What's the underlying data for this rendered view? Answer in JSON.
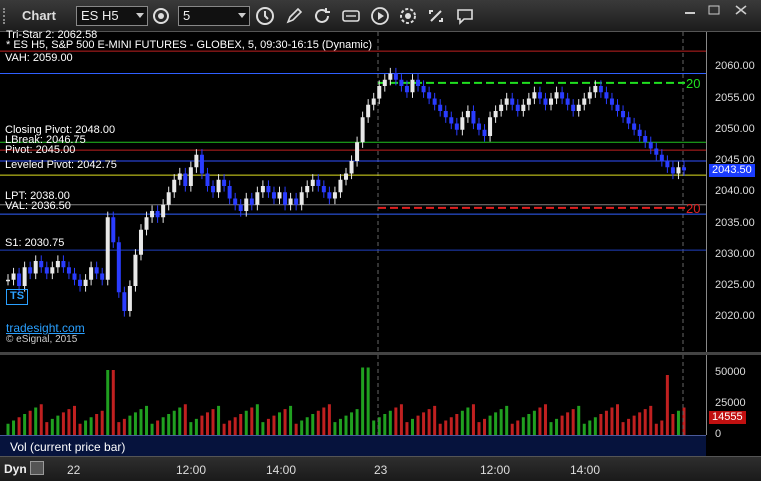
{
  "toolbar": {
    "title": "Chart",
    "symbol": "ES H5",
    "interval": "5"
  },
  "header": {
    "line1": "Tri-Star 2: 2062.58",
    "line2": "* ES H5, S&P 500 E-MINI FUTURES - GLOBEX, 5, 09:30-16:15 (Dynamic)"
  },
  "levels": {
    "vah": "VAH: 2059.00",
    "closing_pivot": "Closing Pivot: 2048.00",
    "lbreak": "LBreak: 2046.75",
    "pivot": "Pivot: 2045.00",
    "leveled_pivot": "Leveled Pivot: 2042.75",
    "lpt": "LPT: 2038.00",
    "val": "VAL: 2036.50",
    "s1": "S1: 2030.75"
  },
  "watermark": {
    "tradesight": "tradesight.com",
    "esignal": "© eSignal, 2015",
    "ts_logo": "TS"
  },
  "price_axis": {
    "ticks": [
      "2060.00",
      "2055.00",
      "2050.00",
      "2045.00",
      "2040.00",
      "2035.00",
      "2030.00",
      "2025.00",
      "2020.00"
    ],
    "current_price": "2043.50"
  },
  "chart_data": {
    "type": "candlestick",
    "ylim": [
      2017,
      2065
    ],
    "price_ticks": [
      2060,
      2055,
      2050,
      2045,
      2040,
      2035,
      2030,
      2025,
      2020
    ],
    "levels": [
      {
        "name": "Tri-Star 2",
        "value": 2062.58,
        "color": "#c02020"
      },
      {
        "name": "VAH",
        "value": 2059.0,
        "color": "#3060ff"
      },
      {
        "name": "Closing Pivot",
        "value": 2048.0,
        "color": "#20c020"
      },
      {
        "name": "LBreak",
        "value": 2046.75,
        "color": "#c02020"
      },
      {
        "name": "Pivot",
        "value": 2045.0,
        "color": "#3050ff"
      },
      {
        "name": "Leveled Pivot",
        "value": 2042.75,
        "color": "#e0e020"
      },
      {
        "name": "LPT",
        "value": 2038.0,
        "color": "#808080"
      },
      {
        "name": "VAL",
        "value": 2036.5,
        "color": "#3060ff"
      },
      {
        "name": "S1",
        "value": 2030.75,
        "color": "#2040c0"
      }
    ],
    "setup_markers": [
      {
        "label": "20",
        "value": 2057.5,
        "color": "#20e020"
      },
      {
        "label": "20",
        "value": 2037.5,
        "color": "#e02020"
      }
    ],
    "closes": [
      2026,
      2027,
      2025,
      2028,
      2027,
      2029,
      2028,
      2027,
      2028,
      2029,
      2028,
      2027,
      2026,
      2025,
      2026,
      2028,
      2027,
      2026,
      2036,
      2032,
      2024,
      2021,
      2025,
      2030,
      2034,
      2036,
      2037,
      2036,
      2038,
      2040,
      2042,
      2043,
      2041,
      2044,
      2046,
      2043,
      2041,
      2040,
      2042,
      2041,
      2039,
      2038,
      2037,
      2039,
      2038,
      2040,
      2041,
      2040,
      2039,
      2040,
      2038,
      2039,
      2038,
      2040,
      2041,
      2042,
      2041,
      2040,
      2039,
      2040,
      2042,
      2043,
      2045,
      2048,
      2052,
      2054,
      2055,
      2057,
      2058,
      2059,
      2058,
      2057,
      2056,
      2058,
      2057,
      2056,
      2055,
      2054,
      2053,
      2052,
      2051,
      2050,
      2052,
      2053,
      2051,
      2050,
      2049,
      2052,
      2053,
      2054,
      2055,
      2054,
      2053,
      2054,
      2055,
      2056,
      2055,
      2054,
      2055,
      2056,
      2055,
      2054,
      2053,
      2054,
      2055,
      2056,
      2057,
      2056,
      2055,
      2054,
      2053,
      2052,
      2051,
      2050,
      2049,
      2048,
      2047,
      2046,
      2045,
      2044,
      2043,
      2044,
      2043.5
    ],
    "volume_ylim": [
      0,
      60000
    ],
    "volume_ticks": [
      50000,
      25000,
      0
    ],
    "current_volume": "14555",
    "time_labels": [
      "22",
      "12:00",
      "14:00",
      "23",
      "12:00",
      "14:00"
    ]
  },
  "volume_axis": {
    "ticks": [
      "50000",
      "25000",
      "0"
    ],
    "current": "14555"
  },
  "volume_pane": {
    "label": "Vol (current price bar)"
  },
  "bottom": {
    "dyn": "Dyn",
    "times": [
      "22",
      "12:00",
      "14:00",
      "23",
      "12:00",
      "14:00"
    ]
  },
  "colors": {
    "up": "#e8e8e8",
    "down": "#2a3cff",
    "vol_up": "#20a020",
    "vol_down": "#c02020",
    "current_price_bg": "#1a3cff",
    "current_vol_bg": "#c01010"
  }
}
